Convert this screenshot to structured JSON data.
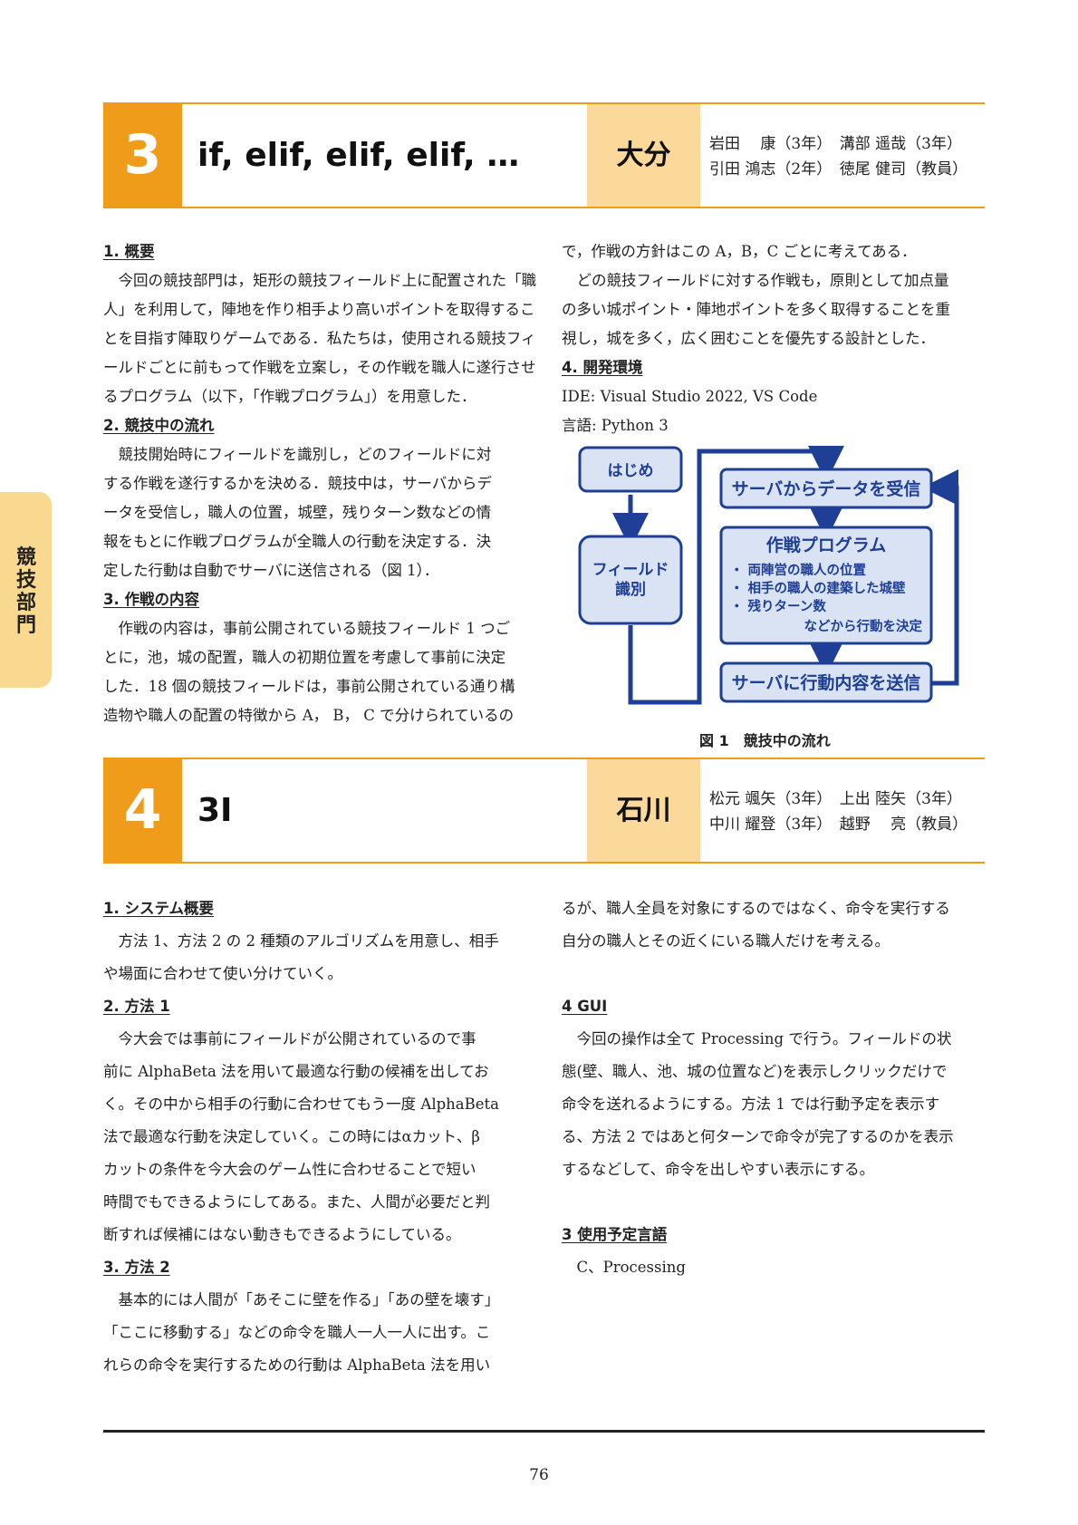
{
  "side_tab": "競技部門",
  "section3": {
    "number": "3",
    "title": "if, elif, elif, elif, …",
    "prefecture": "大分",
    "members": [
      "岩田　 康（3年）　溝部 遥哉（3年）",
      "引田 鴻志（2年）　徳尾 健司（教員）"
    ],
    "left": [
      {
        "type": "h",
        "text": "1. 概要"
      },
      {
        "type": "p",
        "text": "　今回の競技部門は，矩形の競技フィールド上に配置された「職"
      },
      {
        "type": "p",
        "text": "人」を利用して，陣地を作り相手より高いポイントを取得するこ"
      },
      {
        "type": "p",
        "text": "とを目指す陣取りゲームである．私たちは，使用される競技フィ"
      },
      {
        "type": "p",
        "text": "ールドごとに前もって作戦を立案し，その作戦を職人に遂行させ"
      },
      {
        "type": "p",
        "text": "るプログラム（以下，「作戦プログラム」）を用意した．"
      },
      {
        "type": "h",
        "text": "2. 競技中の流れ"
      },
      {
        "type": "p",
        "text": "　競技開始時にフィールドを識別し，どのフィールドに対"
      },
      {
        "type": "p",
        "text": "する作戦を遂行するかを決める．競技中は，サーバからデ"
      },
      {
        "type": "p",
        "text": "ータを受信し，職人の位置，城壁，残りターン数などの情"
      },
      {
        "type": "p",
        "text": "報をもとに作戦プログラムが全職人の行動を決定する．決"
      },
      {
        "type": "p",
        "text": "定した行動は自動でサーバに送信される（図 1）．"
      },
      {
        "type": "h",
        "text": "3. 作戦の内容"
      },
      {
        "type": "p",
        "text": "　作戦の内容は，事前公開されている競技フィールド 1 つご"
      },
      {
        "type": "p",
        "text": "とに，池，城の配置，職人の初期位置を考慮して事前に決定"
      },
      {
        "type": "p",
        "text": "した．18 個の競技フィールドは，事前公開されている通り構"
      },
      {
        "type": "p",
        "text": "造物や職人の配置の特徴から A， B， C で分けられているの"
      }
    ],
    "right": [
      {
        "type": "p",
        "text": "で，作戦の方針はこの A，B，C ごとに考えてある．"
      },
      {
        "type": "p",
        "text": "　どの競技フィールドに対する作戦も，原則として加点量"
      },
      {
        "type": "p",
        "text": "の多い城ポイント・陣地ポイントを多く取得することを重"
      },
      {
        "type": "p",
        "text": "視し，城を多く，広く囲むことを優先する設計とした．"
      },
      {
        "type": "h",
        "text": "4. 開発環境"
      },
      {
        "type": "p",
        "text": "IDE: Visual Studio 2022, VS Code"
      },
      {
        "type": "p",
        "text": "言語: Python 3"
      }
    ],
    "figure": {
      "start": "はじめ",
      "field": [
        "フィールド",
        "識別"
      ],
      "receive": "サーバからデータを受信",
      "program_title": "作戦プログラム",
      "program_items": [
        "・ 両陣営の職人の位置",
        "・ 相手の職人の建築した城壁",
        "・ 残りターン数"
      ],
      "program_tail": "などから行動を決定",
      "send": "サーバに行動内容を送信",
      "caption": "図 1　競技中の流れ",
      "colors": {
        "stroke": "#1f3f96",
        "box_fill": "#d9e3f4",
        "text": "#1f3f96"
      }
    }
  },
  "section4": {
    "number": "4",
    "title": "3I",
    "prefecture": "石川",
    "members": [
      "松元 颯矢（3年）　上出 陸矢（3年）",
      "中川 耀登（3年）　越野　 亮（教員）"
    ],
    "left": [
      {
        "type": "h",
        "text": "1. システム概要"
      },
      {
        "type": "p",
        "text": "　方法 1、方法 2 の 2 種類のアルゴリズムを用意し、相手"
      },
      {
        "type": "p",
        "text": "や場面に合わせて使い分けていく。"
      },
      {
        "type": "h",
        "text": "2. 方法 1"
      },
      {
        "type": "p",
        "text": "　今大会では事前にフィールドが公開されているので事"
      },
      {
        "type": "p",
        "text": "前に AlphaBeta 法を用いて最適な行動の候補を出してお"
      },
      {
        "type": "p",
        "text": "く。その中から相手の行動に合わせてもう一度 AlphaBeta"
      },
      {
        "type": "p",
        "text": "法で最適な行動を決定していく。この時にはαカット、β"
      },
      {
        "type": "p",
        "text": "カットの条件を今大会のゲーム性に合わせることで短い"
      },
      {
        "type": "p",
        "text": "時間でもできるようにしてある。また、人間が必要だと判"
      },
      {
        "type": "p",
        "text": "断すれば候補にはない動きもできるようにしている。"
      },
      {
        "type": "h",
        "text": "3. 方法 2"
      },
      {
        "type": "p",
        "text": "　基本的には人間が「あそこに壁を作る」「あの壁を壊す」"
      },
      {
        "type": "p",
        "text": "「ここに移動する」などの命令を職人一人一人に出す。こ"
      },
      {
        "type": "p",
        "text": "れらの命令を実行するための行動は AlphaBeta 法を用い"
      }
    ],
    "right": [
      {
        "type": "p",
        "text": "るが、職人全員を対象にするのではなく、命令を実行する"
      },
      {
        "type": "p",
        "text": "自分の職人とその近くにいる職人だけを考える。"
      },
      {
        "type": "gap",
        "text": ""
      },
      {
        "type": "h",
        "text": "4 GUI"
      },
      {
        "type": "p",
        "text": "　今回の操作は全て Processing で行う。フィールドの状"
      },
      {
        "type": "p",
        "text": "態(壁、職人、池、城の位置など)を表示しクリックだけで"
      },
      {
        "type": "p",
        "text": "命令を送れるようにする。方法 1 では行動予定を表示す"
      },
      {
        "type": "p",
        "text": "る、方法 2 ではあと何ターンで命令が完了するのかを表示"
      },
      {
        "type": "p",
        "text": "するなどして、命令を出しやすい表示にする。"
      },
      {
        "type": "gap",
        "text": ""
      },
      {
        "type": "h",
        "text": "3 使用予定言語"
      },
      {
        "type": "p",
        "text": "　C、Processing"
      }
    ]
  },
  "page_number": "76"
}
